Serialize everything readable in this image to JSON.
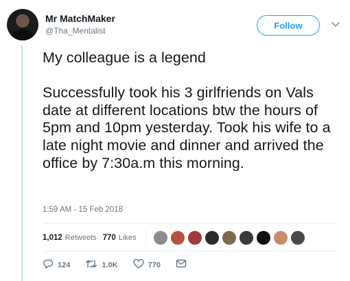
{
  "user": {
    "display_name": "Mr MatchMaker",
    "handle": "@Tha_Mentalist"
  },
  "follow_label": "Follow",
  "tweet": {
    "text": "My colleague is a legend\n\nSuccessfully took his 3 girlfriends on Vals date at different locations btw the hours of 5pm and 10pm yesterday. Took his wife to a late night movie and dinner and arrived the office by 7:30a.m this morning.",
    "timestamp": "1:59 AM - 15 Feb 2018"
  },
  "stats": {
    "retweets_count": "1,012",
    "retweets_label": "Retweets",
    "likes_count": "770",
    "likes_label": "Likes"
  },
  "likers": [
    {
      "name": "liker-avatar-1",
      "color": "#8c8c8c"
    },
    {
      "name": "liker-avatar-2",
      "color": "#b5523b"
    },
    {
      "name": "liker-avatar-3",
      "color": "#a33a3a"
    },
    {
      "name": "liker-avatar-4",
      "color": "#2b2b2b"
    },
    {
      "name": "liker-avatar-5",
      "color": "#7a6a4f"
    },
    {
      "name": "liker-avatar-6",
      "color": "#3a3a3a"
    },
    {
      "name": "liker-avatar-7",
      "color": "#111111"
    },
    {
      "name": "liker-avatar-8",
      "color": "#c98b6b"
    },
    {
      "name": "liker-avatar-9",
      "color": "#4a4a4a"
    }
  ],
  "actions": {
    "reply_count": "124",
    "retweet_count": "1.0K",
    "like_count": "770"
  },
  "colors": {
    "accent": "#1da1f2",
    "secondary_text": "#657786",
    "thread_line": "#c4e0f6"
  }
}
